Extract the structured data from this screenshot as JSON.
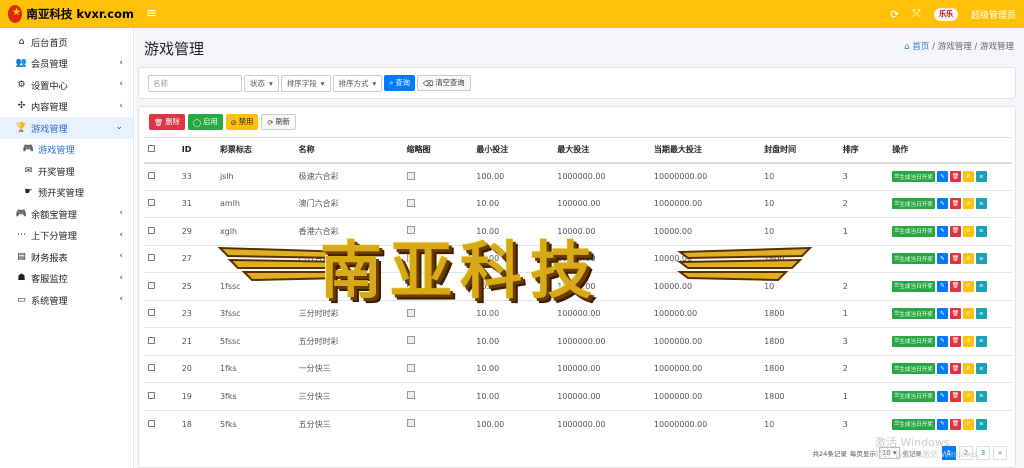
{
  "header": {
    "brand": "南亚科技 kvxr.com",
    "avatar_text": "乐乐",
    "user": "超级管理员"
  },
  "sidebar": {
    "items": [
      {
        "label": "后台首页",
        "icon": "home-icon",
        "glyph": "⌂",
        "chev": ""
      },
      {
        "label": "会员管理",
        "icon": "users-icon",
        "glyph": "👥",
        "chev": "‹"
      },
      {
        "label": "设置中心",
        "icon": "cogs-icon",
        "glyph": "⚙",
        "chev": "‹"
      },
      {
        "label": "内容管理",
        "icon": "compress-icon",
        "glyph": "✣",
        "chev": "‹"
      },
      {
        "label": "游戏管理",
        "icon": "trophy-icon",
        "glyph": "🏆",
        "chev": "⌄"
      },
      {
        "label": "游戏管理",
        "icon": "gamepad-icon",
        "glyph": "🎮",
        "chev": ""
      },
      {
        "label": "开奖管理",
        "icon": "envelope-icon",
        "glyph": "✉",
        "chev": ""
      },
      {
        "label": "预开奖管理",
        "icon": "hand-icon",
        "glyph": "☛",
        "chev": ""
      },
      {
        "label": "余额宝管理",
        "icon": "gamepad-icon",
        "glyph": "🎮",
        "chev": "‹"
      },
      {
        "label": "上下分管理",
        "icon": "pay-icon",
        "glyph": "⋯",
        "chev": "‹"
      },
      {
        "label": "财务报表",
        "icon": "book-icon",
        "glyph": "▤",
        "chev": "‹"
      },
      {
        "label": "客服监控",
        "icon": "user-secret-icon",
        "glyph": "☗",
        "chev": "‹"
      },
      {
        "label": "系统管理",
        "icon": "desktop-icon",
        "glyph": "▭",
        "chev": "‹"
      }
    ]
  },
  "page": {
    "title": "游戏管理",
    "crumb_home": "首页",
    "crumb_mid": "游戏管理",
    "crumb_cur": "游戏管理"
  },
  "filter": {
    "name_placeholder": "名称",
    "status": "状态",
    "sort_field": "排序字段",
    "sort_way": "排序方式",
    "search": "查询",
    "clear": "清空查询"
  },
  "toolbar": {
    "delete": "删除",
    "enable": "启用",
    "disable": "禁用",
    "refresh": "刷新"
  },
  "table": {
    "headers": [
      "ID",
      "彩票标志",
      "名称",
      "缩略图",
      "最小投注",
      "最大投注",
      "当期最大投注",
      "封盘时间",
      "排序",
      "操作"
    ],
    "op_label": "生成当日开奖",
    "rows": [
      [
        "33",
        "jslh",
        "极速六合彩",
        "",
        "100.00",
        "1000000.00",
        "10000000.00",
        "10",
        "3"
      ],
      [
        "31",
        "amlh",
        "澳门六合彩",
        "",
        "10.00",
        "100000.00",
        "1000000.00",
        "10",
        "2"
      ],
      [
        "29",
        "xglh",
        "香港六合彩",
        "",
        "10.00",
        "10000.00",
        "10000.00",
        "10",
        "1"
      ],
      [
        "27",
        "",
        "门六合彩",
        "",
        "10.00",
        "10000.00",
        "10000.00",
        "1800",
        ""
      ],
      [
        "25",
        "1fssc",
        "",
        "",
        "10.00",
        "10000.00",
        "10000.00",
        "10",
        "2"
      ],
      [
        "23",
        "3fssc",
        "三分时时彩",
        "",
        "10.00",
        "100000.00",
        "100000.00",
        "1800",
        "1"
      ],
      [
        "21",
        "5fssc",
        "五分时时彩",
        "",
        "10.00",
        "1000000.00",
        "1000000.00",
        "1800",
        "3"
      ],
      [
        "20",
        "1fks",
        "一分快三",
        "",
        "10.00",
        "100000.00",
        "1000000.00",
        "1800",
        "2"
      ],
      [
        "19",
        "3fks",
        "三分快三",
        "",
        "10.00",
        "100000.00",
        "1000000.00",
        "1800",
        "1"
      ],
      [
        "18",
        "5fks",
        "五分快三",
        "",
        "100.00",
        "1000000.00",
        "10000000.00",
        "10",
        "3"
      ]
    ]
  },
  "pager": {
    "total": "共24条记录",
    "per_page": "每页显示",
    "per_val": "10",
    "unit": "条记录",
    "prev": "‹",
    "pages": [
      "1",
      "2",
      "3"
    ],
    "next": "»"
  },
  "watermark": {
    "text": "南亚科技"
  },
  "windows": {
    "line1": "激活 Windows",
    "line2": "转到\"设置\"以激活 Windows。"
  }
}
